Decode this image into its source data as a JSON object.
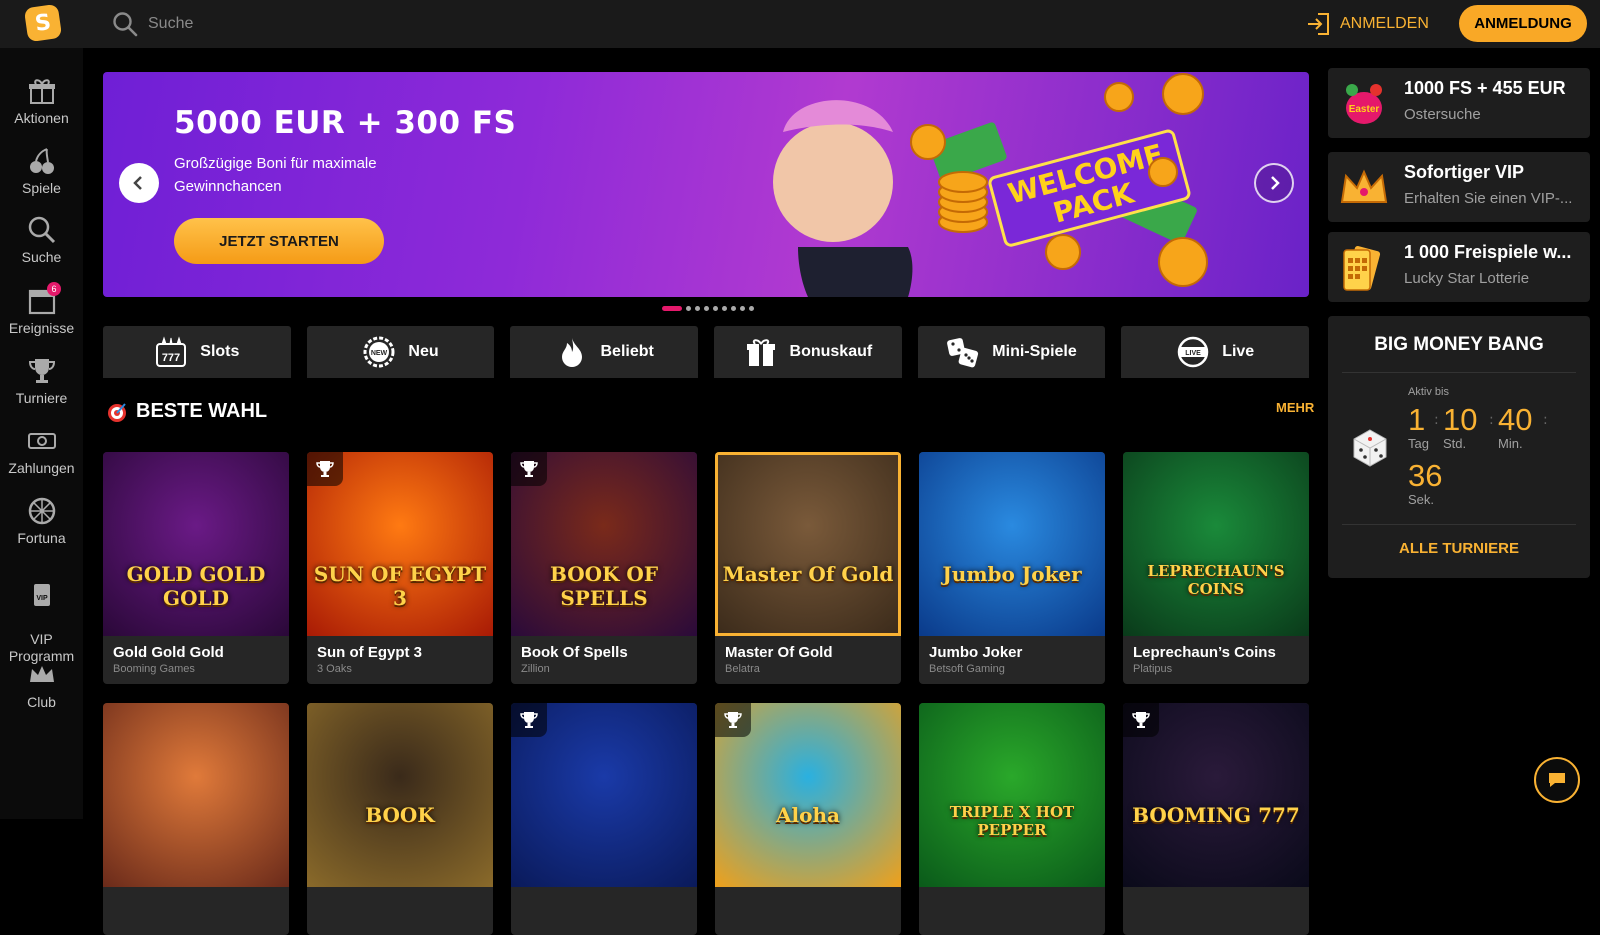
{
  "header": {
    "logo_letter": "S",
    "search_placeholder": "Suche",
    "login_label": "ANMELDEN",
    "register_label": "ANMELDUNG"
  },
  "sidebar": {
    "items": [
      {
        "label": "Aktionen",
        "icon": "gift-icon"
      },
      {
        "label": "Spiele",
        "icon": "cherries-icon"
      },
      {
        "label": "Suche",
        "icon": "search-icon"
      },
      {
        "label": "Ereignisse",
        "icon": "calendar-icon",
        "badge": "6"
      },
      {
        "label": "Turniere",
        "icon": "trophy-icon"
      },
      {
        "label": "Zahlungen",
        "icon": "cash-icon"
      },
      {
        "label": "Fortuna",
        "icon": "wheel-icon"
      },
      {
        "label": "VIP\nProgramm",
        "icon": "vip-card-icon"
      },
      {
        "label": "Club",
        "icon": "crown-icon"
      }
    ]
  },
  "hero": {
    "title": "5000 EUR + 300 FS",
    "subtitle": "Großzügige Boni für maximale Gewinnchancen",
    "cta": "JETZT STARTEN",
    "art_text_line1": "WELCOME",
    "art_text_line2": "PACK",
    "dots_count": 9,
    "active_dot": 0
  },
  "categories": [
    {
      "label": "Slots",
      "icon": "slot-777-icon"
    },
    {
      "label": "Neu",
      "icon": "new-badge-icon"
    },
    {
      "label": "Beliebt",
      "icon": "flame-icon"
    },
    {
      "label": "Bonuskauf",
      "icon": "gift-icon"
    },
    {
      "label": "Mini-Spiele",
      "icon": "dice-icon"
    },
    {
      "label": "Live",
      "icon": "live-icon"
    }
  ],
  "section": {
    "title": "BESTE WAHL",
    "more": "MEHR"
  },
  "games": [
    {
      "name": "Gold Gold Gold",
      "provider": "Booming Games",
      "thumb_text": "GOLD GOLD GOLD",
      "trophy": false,
      "highlight": false,
      "colors": [
        "#6a1a86",
        "#2a0838"
      ]
    },
    {
      "name": "Sun of Egypt 3",
      "provider": "3 Oaks",
      "thumb_text": "SUN OF EGYPT 3",
      "trophy": true,
      "highlight": false,
      "colors": [
        "#ff7a12",
        "#a81a05"
      ]
    },
    {
      "name": "Book Of Spells",
      "provider": "Zillion",
      "thumb_text": "BOOK OF SPELLS",
      "trophy": true,
      "highlight": false,
      "colors": [
        "#7a2a1a",
        "#2a0a3a"
      ]
    },
    {
      "name": "Master Of Gold",
      "provider": "Belatra",
      "thumb_text": "Master Of Gold",
      "trophy": false,
      "highlight": true,
      "colors": [
        "#7a5a3a",
        "#3a2a1a"
      ]
    },
    {
      "name": "Jumbo Joker",
      "provider": "Betsoft Gaming",
      "thumb_text": "Jumbo Joker",
      "trophy": false,
      "highlight": false,
      "colors": [
        "#2a8ae0",
        "#0a3a8a"
      ]
    },
    {
      "name": "Leprechaun’s Coins",
      "provider": "Platipus",
      "thumb_text": "LEPRECHAUN'S COINS",
      "trophy": false,
      "highlight": false,
      "colors": [
        "#1a8a3a",
        "#0a3a1a"
      ]
    },
    {
      "name": "",
      "provider": "",
      "thumb_text": "",
      "trophy": false,
      "highlight": false,
      "colors": [
        "#e07a3a",
        "#6a2a1a"
      ]
    },
    {
      "name": "",
      "provider": "",
      "thumb_text": "BOOK",
      "trophy": false,
      "highlight": false,
      "colors": [
        "#3a2a1a",
        "#8a6a2a"
      ]
    },
    {
      "name": "",
      "provider": "",
      "thumb_text": "",
      "trophy": true,
      "highlight": false,
      "colors": [
        "#1a3aa8",
        "#0a1a5a"
      ]
    },
    {
      "name": "",
      "provider": "",
      "thumb_text": "Aloha",
      "trophy": true,
      "highlight": false,
      "colors": [
        "#2ab0e0",
        "#f0a01a"
      ]
    },
    {
      "name": "",
      "provider": "",
      "thumb_text": "TRIPLE X HOT PEPPER",
      "trophy": false,
      "highlight": false,
      "colors": [
        "#2aa82a",
        "#0a5a1a"
      ]
    },
    {
      "name": "",
      "provider": "",
      "thumb_text": "BOOMING 777",
      "trophy": true,
      "highlight": false,
      "colors": [
        "#2a1a3a",
        "#0a0a1a"
      ]
    }
  ],
  "promos": [
    {
      "title": "1000 FS + 455 EUR",
      "subtitle": "Ostersuche",
      "icon": "easter-egg-icon"
    },
    {
      "title": "Sofortiger VIP",
      "subtitle": "Erhalten Sie einen VIP-...",
      "icon": "crown-icon"
    },
    {
      "title": "1 000 Freispiele w...",
      "subtitle": "Lucky Star Lotterie",
      "icon": "lottery-ticket-icon"
    }
  ],
  "tournament": {
    "title": "BIG MONEY BANG",
    "active_label": "Aktiv bis",
    "days": "1",
    "days_unit": "Tag",
    "hours": "10",
    "hours_unit": "Std.",
    "minutes": "40",
    "minutes_unit": "Min.",
    "seconds": "36",
    "seconds_unit": "Sek.",
    "all_label": "ALLE TURNIERE"
  },
  "colors": {
    "accent": "#f9b233",
    "pink": "#e5196b",
    "panel": "#262626"
  }
}
